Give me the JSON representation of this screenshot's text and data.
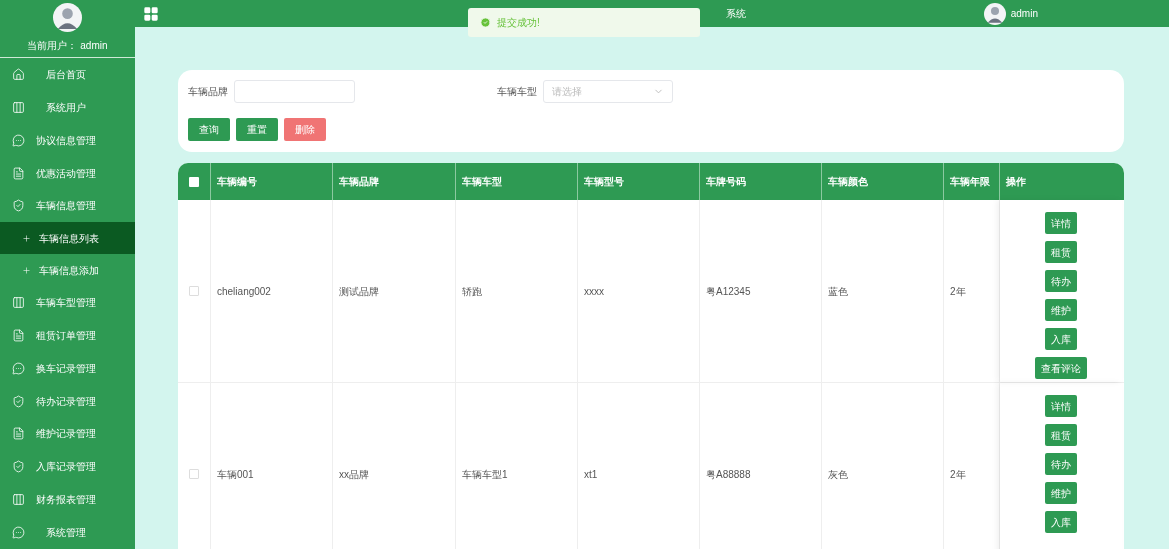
{
  "sidebar": {
    "current_user_label": "当前用户：",
    "current_user": "admin",
    "items": [
      {
        "label": "后台首页",
        "kind": "home",
        "selected": false
      },
      {
        "label": "系统用户",
        "kind": "columns",
        "selected": false
      },
      {
        "label": "协议信息管理",
        "kind": "chat",
        "selected": false
      },
      {
        "label": "优惠活动管理",
        "kind": "document",
        "selected": false
      },
      {
        "label": "车辆信息管理",
        "kind": "shield",
        "selected": false,
        "expanded": true,
        "children": [
          {
            "label": "车辆信息列表",
            "selected": true
          },
          {
            "label": "车辆信息添加",
            "selected": false
          }
        ]
      },
      {
        "label": "车辆车型管理",
        "kind": "columns",
        "selected": false
      },
      {
        "label": "租赁订单管理",
        "kind": "document",
        "selected": false
      },
      {
        "label": "换车记录管理",
        "kind": "chat",
        "selected": false
      },
      {
        "label": "待办记录管理",
        "kind": "shield",
        "selected": false
      },
      {
        "label": "维护记录管理",
        "kind": "document",
        "selected": false
      },
      {
        "label": "入库记录管理",
        "kind": "shield",
        "selected": false
      },
      {
        "label": "财务报表管理",
        "kind": "columns",
        "selected": false
      },
      {
        "label": "系统管理",
        "kind": "chat",
        "selected": false
      }
    ]
  },
  "header": {
    "title": "系统",
    "user": "admin"
  },
  "toast": {
    "message": "提交成功!"
  },
  "search": {
    "fields": [
      {
        "kind": "input",
        "label": "车辆品牌"
      },
      {
        "kind": "select",
        "label": "车辆车型",
        "placeholder": "请选择"
      }
    ],
    "buttons": [
      {
        "label": "查询",
        "kind": "primary"
      },
      {
        "label": "重置",
        "kind": "primary"
      },
      {
        "label": "删除",
        "kind": "danger"
      }
    ]
  },
  "table": {
    "select_all_checked": false,
    "columns": [
      "车辆编号",
      "车辆品牌",
      "车辆车型",
      "车辆型号",
      "车牌号码",
      "车辆颜色",
      "车辆年限",
      "操作"
    ],
    "rows": [
      {
        "checked": false,
        "cells": [
          "cheliang002",
          "测试品牌",
          "轿跑",
          "xxxx",
          "粤A12345",
          "蓝色",
          "2年"
        ],
        "actions": [
          "详情",
          "租赁",
          "待办",
          "维护",
          "入库",
          "查看评论"
        ]
      },
      {
        "checked": false,
        "cells": [
          "车辆001",
          "xx品牌",
          "车辆车型1",
          "xt1",
          "粤A88888",
          "灰色",
          "2年"
        ],
        "actions": [
          "详情",
          "租赁",
          "待办",
          "维护",
          "入库"
        ]
      }
    ]
  }
}
